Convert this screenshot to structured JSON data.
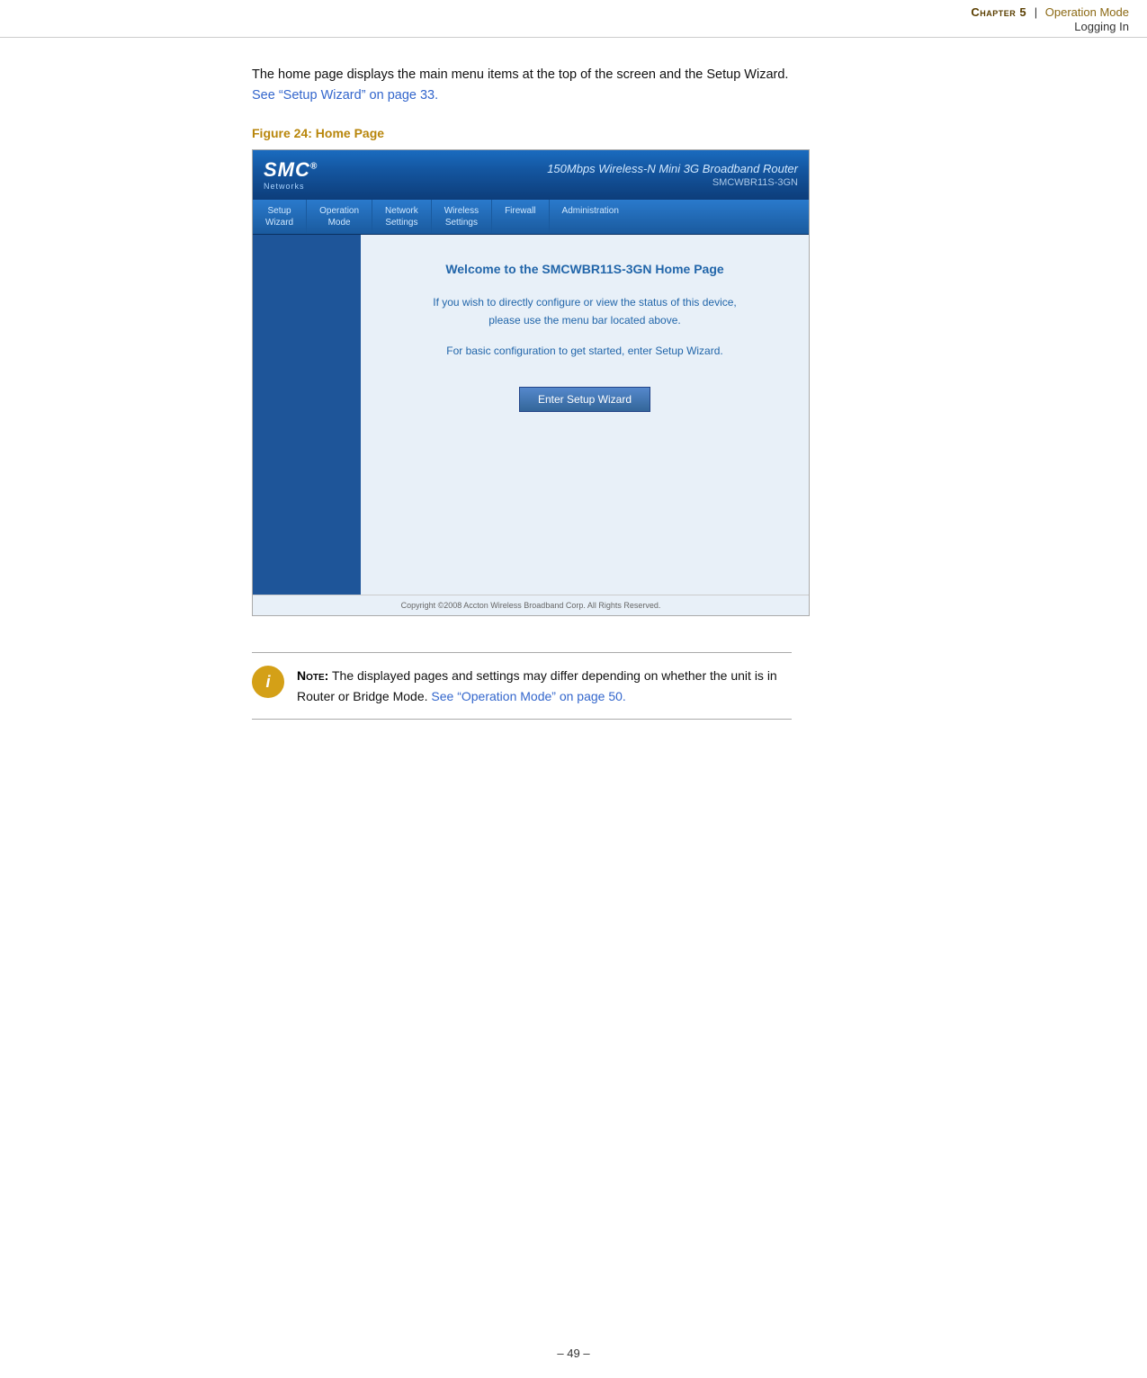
{
  "header": {
    "chapter_label": "Chapter 5",
    "separator": "|",
    "breadcrumb_link": "Operation Mode",
    "current_page": "Logging In"
  },
  "intro": {
    "text": "The home page displays the main menu items at the top of the screen and the Setup Wizard.",
    "link_text": "See “Setup Wizard” on page 33.",
    "link_href": "#"
  },
  "figure": {
    "label": "Figure 24:",
    "title": "Home Page"
  },
  "router_ui": {
    "logo": "SMC®",
    "logo_sub": "Networks",
    "title_main": "150Mbps Wireless-N Mini 3G Broadband Router",
    "title_model": "SMCWBR11S-3GN",
    "nav_items": [
      {
        "label": "Setup\nWizard"
      },
      {
        "label": "Operation\nMode"
      },
      {
        "label": "Network\nSettings"
      },
      {
        "label": "Wireless\nSettings"
      },
      {
        "label": "Firewall"
      },
      {
        "label": "Administration"
      }
    ],
    "welcome_text": "Welcome to the SMCWBR11S-3GN Home Page",
    "desc1": "If you wish to directly configure or view the status of this device,",
    "desc2": "please use the menu bar located above.",
    "desc3": "For basic configuration to get started, enter Setup Wizard.",
    "setup_btn": "Enter Setup Wizard",
    "footer": "Copyright ©2008 Accton Wireless Broadband Corp. All Rights Reserved."
  },
  "note": {
    "label": "Note:",
    "text": "The displayed pages and settings may differ depending on whether the unit is in Router or Bridge Mode.",
    "link_text": "See “Operation Mode” on page 50.",
    "link_href": "#"
  },
  "page_number": "– 49 –"
}
